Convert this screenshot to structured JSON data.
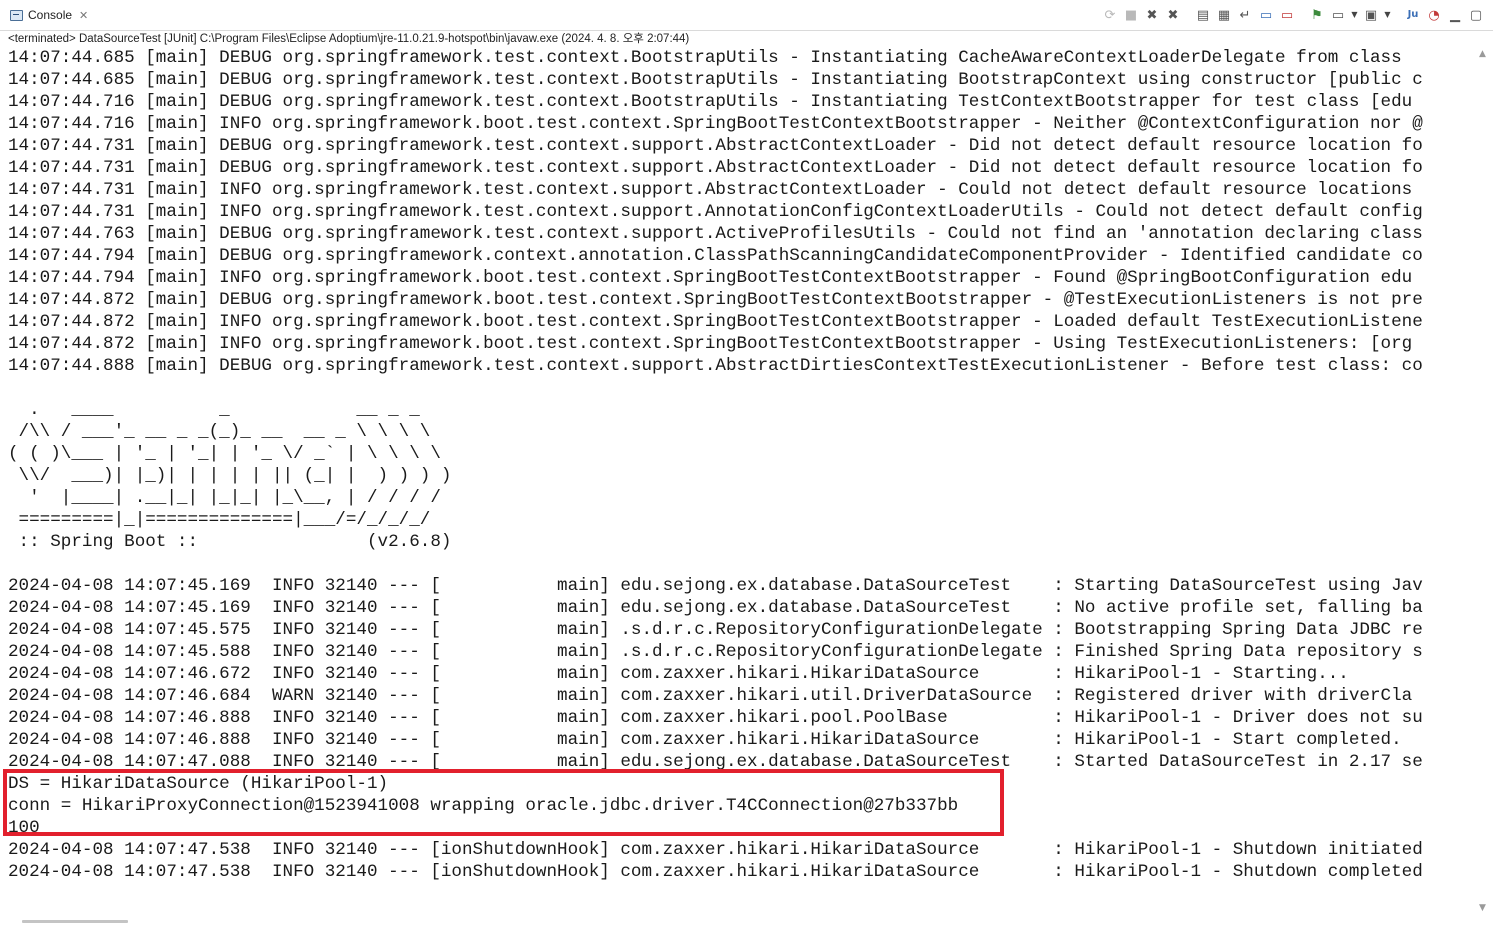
{
  "tab": {
    "label": "Console",
    "icon": "console-icon",
    "close_glyph": "✕"
  },
  "toolbar": {
    "buttons": [
      {
        "name": "relaunch-icon",
        "glyph": "⟳"
      },
      {
        "name": "terminate-icon",
        "glyph": "■"
      },
      {
        "name": "remove-launch-icon",
        "glyph": "✖"
      },
      {
        "name": "remove-all-terminated-icon",
        "glyph": "✖"
      },
      {
        "name": "clear-console-icon",
        "glyph": "▤"
      },
      {
        "name": "scroll-lock-icon",
        "glyph": "▦"
      },
      {
        "name": "word-wrap-icon",
        "glyph": "↵"
      },
      {
        "name": "show-on-stdout-icon",
        "glyph": "▭"
      },
      {
        "name": "show-on-stderr-icon",
        "glyph": "▭"
      },
      {
        "name": "pin-console-icon",
        "glyph": "⚑"
      },
      {
        "name": "display-selected-console-icon",
        "glyph": "▭"
      },
      {
        "name": "open-console-icon",
        "glyph": "▣"
      },
      {
        "name": "junit-icon",
        "glyph": "Ju"
      },
      {
        "name": "eclipse-icon",
        "glyph": "◔"
      },
      {
        "name": "minimize-icon",
        "glyph": "▁"
      },
      {
        "name": "maximize-icon",
        "glyph": "▢"
      }
    ]
  },
  "status": {
    "text": "<terminated> DataSourceTest [JUnit] C:\\Program Files\\Eclipse Adoptium\\jre-11.0.21.9-hotspot\\bin\\javaw.exe  (2024. 4. 8. 오후 2:07:44)"
  },
  "console": {
    "lines": [
      "14:07:44.685 [main] DEBUG org.springframework.test.context.BootstrapUtils - Instantiating CacheAwareContextLoaderDelegate from class",
      "14:07:44.685 [main] DEBUG org.springframework.test.context.BootstrapUtils - Instantiating BootstrapContext using constructor [public c",
      "14:07:44.716 [main] DEBUG org.springframework.test.context.BootstrapUtils - Instantiating TestContextBootstrapper for test class [edu",
      "14:07:44.716 [main] INFO org.springframework.boot.test.context.SpringBootTestContextBootstrapper - Neither @ContextConfiguration nor @",
      "14:07:44.731 [main] DEBUG org.springframework.test.context.support.AbstractContextLoader - Did not detect default resource location fo",
      "14:07:44.731 [main] DEBUG org.springframework.test.context.support.AbstractContextLoader - Did not detect default resource location fo",
      "14:07:44.731 [main] INFO org.springframework.test.context.support.AbstractContextLoader - Could not detect default resource locations",
      "14:07:44.731 [main] INFO org.springframework.test.context.support.AnnotationConfigContextLoaderUtils - Could not detect default config",
      "14:07:44.763 [main] DEBUG org.springframework.test.context.support.ActiveProfilesUtils - Could not find an 'annotation declaring class",
      "14:07:44.794 [main] DEBUG org.springframework.context.annotation.ClassPathScanningCandidateComponentProvider - Identified candidate co",
      "14:07:44.794 [main] INFO org.springframework.boot.test.context.SpringBootTestContextBootstrapper - Found @SpringBootConfiguration edu",
      "14:07:44.872 [main] DEBUG org.springframework.boot.test.context.SpringBootTestContextBootstrapper - @TestExecutionListeners is not pre",
      "14:07:44.872 [main] INFO org.springframework.boot.test.context.SpringBootTestContextBootstrapper - Loaded default TestExecutionListene",
      "14:07:44.872 [main] INFO org.springframework.boot.test.context.SpringBootTestContextBootstrapper - Using TestExecutionListeners: [org",
      "14:07:44.888 [main] DEBUG org.springframework.test.context.support.AbstractDirtiesContextTestExecutionListener - Before test class: co",
      "",
      "  .   ____          _            __ _ _",
      " /\\\\ / ___'_ __ _ _(_)_ __  __ _ \\ \\ \\ \\",
      "( ( )\\___ | '_ | '_| | '_ \\/ _` | \\ \\ \\ \\",
      " \\\\/  ___)| |_)| | | | | || (_| |  ) ) ) )",
      "  '  |____| .__|_| |_|_| |_\\__, | / / / /",
      " =========|_|==============|___/=/_/_/_/",
      " :: Spring Boot ::                (v2.6.8)",
      "",
      "2024-04-08 14:07:45.169  INFO 32140 --- [           main] edu.sejong.ex.database.DataSourceTest    : Starting DataSourceTest using Jav",
      "2024-04-08 14:07:45.169  INFO 32140 --- [           main] edu.sejong.ex.database.DataSourceTest    : No active profile set, falling ba",
      "2024-04-08 14:07:45.575  INFO 32140 --- [           main] .s.d.r.c.RepositoryConfigurationDelegate : Bootstrapping Spring Data JDBC re",
      "2024-04-08 14:07:45.588  INFO 32140 --- [           main] .s.d.r.c.RepositoryConfigurationDelegate : Finished Spring Data repository s",
      "2024-04-08 14:07:46.672  INFO 32140 --- [           main] com.zaxxer.hikari.HikariDataSource       : HikariPool-1 - Starting...",
      "2024-04-08 14:07:46.684  WARN 32140 --- [           main] com.zaxxer.hikari.util.DriverDataSource  : Registered driver with driverCla",
      "2024-04-08 14:07:46.888  INFO 32140 --- [           main] com.zaxxer.hikari.pool.PoolBase          : HikariPool-1 - Driver does not su",
      "2024-04-08 14:07:46.888  INFO 32140 --- [           main] com.zaxxer.hikari.HikariDataSource       : HikariPool-1 - Start completed.",
      "2024-04-08 14:07:47.088  INFO 32140 --- [           main] edu.sejong.ex.database.DataSourceTest    : Started DataSourceTest in 2.17 se",
      "DS = HikariDataSource (HikariPool-1)",
      "conn = HikariProxyConnection@1523941008 wrapping oracle.jdbc.driver.T4CConnection@27b337bb",
      "100",
      "2024-04-08 14:07:47.538  INFO 32140 --- [ionShutdownHook] com.zaxxer.hikari.HikariDataSource       : HikariPool-1 - Shutdown initiated",
      "2024-04-08 14:07:47.538  INFO 32140 --- [ionShutdownHook] com.zaxxer.hikari.HikariDataSource       : HikariPool-1 - Shutdown completed"
    ]
  },
  "colors": {
    "highlight_border": "#e2202d",
    "text": "#1a1a1a"
  }
}
